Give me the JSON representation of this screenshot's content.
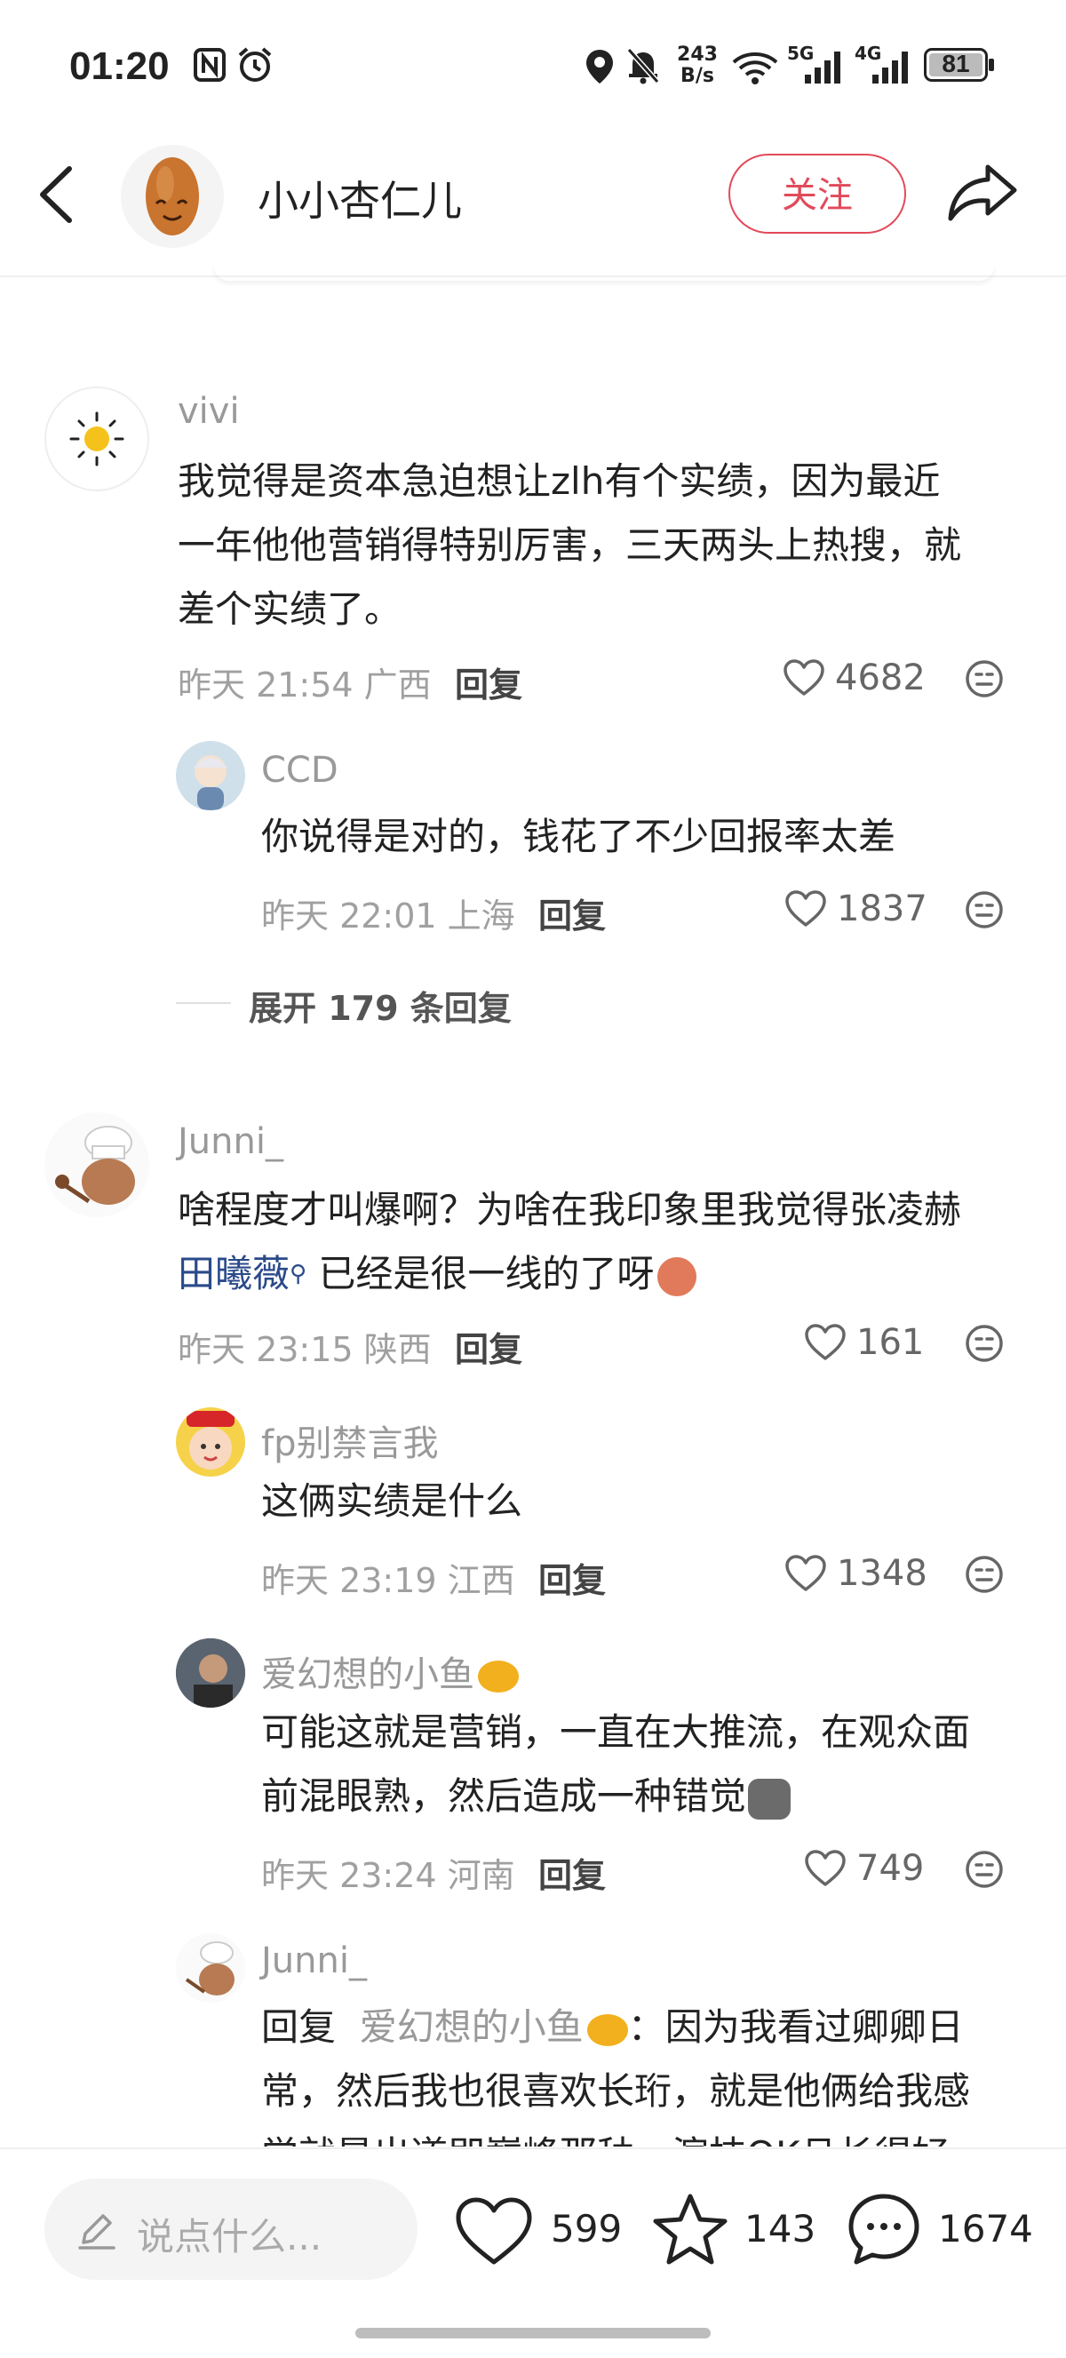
{
  "status_bar": {
    "time": "01:20",
    "net_speed_top": "243",
    "net_speed_bottom": "B/s",
    "sig1": "5G",
    "sig2": "4G",
    "battery": "81"
  },
  "header": {
    "author": "小小杏仁儿",
    "follow_label": "关注"
  },
  "comments": [
    {
      "user": "vivi",
      "text_lines": [
        "我觉得是资本急迫想让zlh有个实绩，因为最近",
        "一年他他营销得特别厉害，三天两头上热搜，就",
        "差个实绩了。"
      ],
      "time": "昨天 21:54 广西",
      "reply_label": "回复",
      "likes": "4682",
      "replies": [
        {
          "user": "CCD",
          "text": "你说得是对的，钱花了不少回报率太差",
          "time": "昨天 22:01 上海",
          "reply_label": "回复",
          "likes": "1837"
        }
      ],
      "expand_label": "展开 179 条回复"
    },
    {
      "user": "Junni_",
      "text_line1": "啥程度才叫爆啊？为啥在我印象里我觉得张凌赫",
      "link_text": "田曦薇",
      "text_line2_rest": "已经是很一线的了呀",
      "time": "昨天 23:15 陕西",
      "reply_label": "回复",
      "likes": "161",
      "replies": [
        {
          "user": "fp别禁言我",
          "text": "这俩实绩是什么",
          "time": "昨天 23:19 江西",
          "reply_label": "回复",
          "likes": "1348"
        },
        {
          "user": "爱幻想的小鱼",
          "text_lines": [
            "可能这就是营销，一直在大推流，在观众面",
            "前混眼熟，然后造成一种错觉"
          ],
          "time": "昨天 23:24 河南",
          "reply_label": "回复",
          "likes": "749"
        },
        {
          "user": "Junni_",
          "reply_prefix": "回复",
          "reply_to": "爱幻想的小鱼",
          "text_line1_rest": "：因为我看过卿卿日",
          "text_line2": "常，然后我也很喜欢长珩，就是他俩给我感",
          "text_line3": "觉就是出道即巅峰那种，演技OK且长得好"
        }
      ]
    }
  ],
  "bottom": {
    "placeholder": "说点什么...",
    "likes": "599",
    "stars": "143",
    "comments": "1674"
  },
  "colors": {
    "accent_red": "#e24a5a",
    "link_blue": "#2a4a8a",
    "meta_gray": "#a0a0a0"
  },
  "icons": [
    "back-icon",
    "share-icon",
    "heart-icon",
    "dislike-face-icon",
    "star-icon",
    "comment-bubble-icon",
    "pencil-icon",
    "location-icon",
    "mute-bell-icon",
    "alarm-icon",
    "nfc-icon",
    "wifi-icon",
    "battery-icon"
  ]
}
